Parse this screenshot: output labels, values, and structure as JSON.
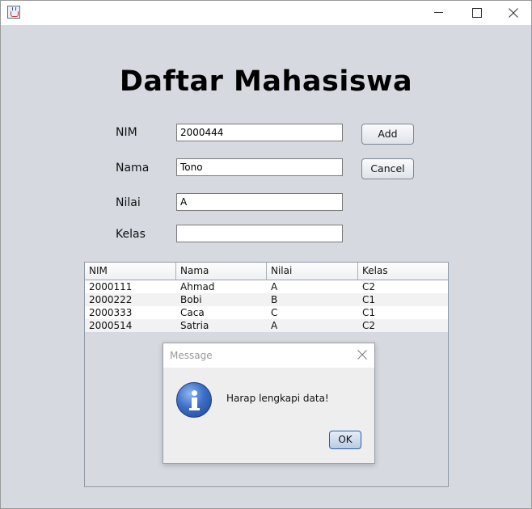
{
  "window": {
    "icon": "java-cup-icon"
  },
  "header": {
    "title": "Daftar Mahasiswa"
  },
  "form": {
    "nim_label": "NIM",
    "nim_value": "2000444",
    "nama_label": "Nama",
    "nama_value": "Tono",
    "nilai_label": "Nilai",
    "nilai_value": "A",
    "kelas_label": "Kelas",
    "kelas_value": "",
    "add_label": "Add",
    "cancel_label": "Cancel"
  },
  "table": {
    "headers": [
      "NIM",
      "Nama",
      "Nilai",
      "Kelas"
    ],
    "rows": [
      [
        "2000111",
        "Ahmad",
        "A",
        "C2"
      ],
      [
        "2000222",
        "Bobi",
        "B",
        "C1"
      ],
      [
        "2000333",
        "Caca",
        "C",
        "C1"
      ],
      [
        "2000514",
        "Satria",
        "A",
        "C2"
      ]
    ]
  },
  "dialog": {
    "title": "Message",
    "message": "Harap lengkapi data!",
    "ok_label": "OK",
    "icon": "information-icon"
  },
  "colors": {
    "window_bg": "#d6d9e0",
    "info_blue": "#3c6fc7"
  }
}
